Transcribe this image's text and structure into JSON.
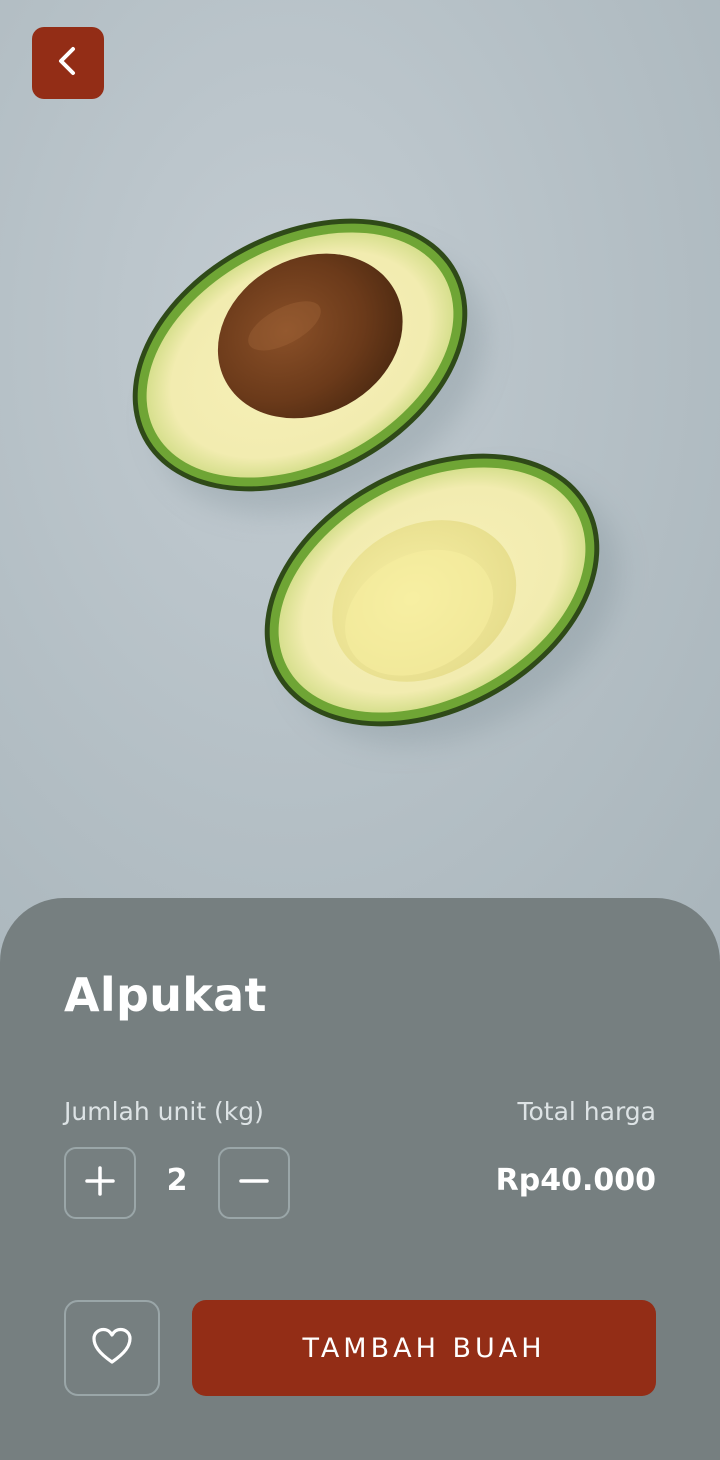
{
  "colors": {
    "accent": "#932d16",
    "sheet": "#767f80",
    "background": "#b9c4ca"
  },
  "header": {
    "back_icon": "chevron-left-icon"
  },
  "product": {
    "name": "Alpukat",
    "image_icon": "avocado-halves-illustration"
  },
  "quantity": {
    "label": "Jumlah unit (kg)",
    "value": "2",
    "increment_icon": "plus-icon",
    "decrement_icon": "minus-icon"
  },
  "total": {
    "label": "Total harga",
    "value": "Rp40.000"
  },
  "actions": {
    "favorite_icon": "heart-outline-icon",
    "add_label": "TAMBAH BUAH"
  }
}
